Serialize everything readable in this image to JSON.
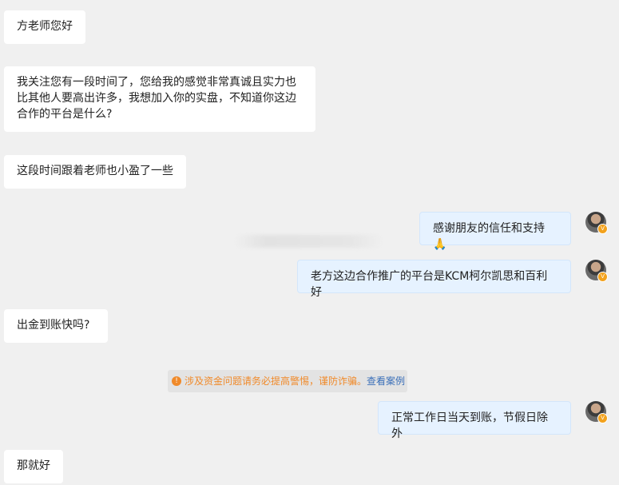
{
  "messages": [
    {
      "side": "left",
      "text": "方老师您好"
    },
    {
      "side": "left",
      "text": "我关注您有一段时间了，您给我的感觉非常真诚且实力也比其他人要高出许多，我想加入你的实盘，不知道你这边合作的平台是什么?"
    },
    {
      "side": "left",
      "text": "这段时间跟着老师也小盈了一些"
    },
    {
      "side": "right",
      "text": "感谢朋友的信任和支持🙏"
    },
    {
      "side": "right",
      "text": "老方这边合作推广的平台是KCM柯尔凯思和百利好"
    },
    {
      "side": "left",
      "text": "出金到账快吗?"
    },
    {
      "side": "right",
      "text": "正常工作日当天到账，节假日除外"
    },
    {
      "side": "left",
      "text": "那就好"
    }
  ],
  "notice": {
    "icon": "info-icon",
    "text": "涉及资金问题请务必提高警惕，谨防诈骗。",
    "link": "查看案例"
  },
  "avatar_badge": "V",
  "colors": {
    "bg": "#f0f0f0",
    "left_bubble": "#ffffff",
    "right_bubble": "#e6f2ff",
    "notice_text": "#f08a2a",
    "notice_link": "#3a6fb8"
  }
}
